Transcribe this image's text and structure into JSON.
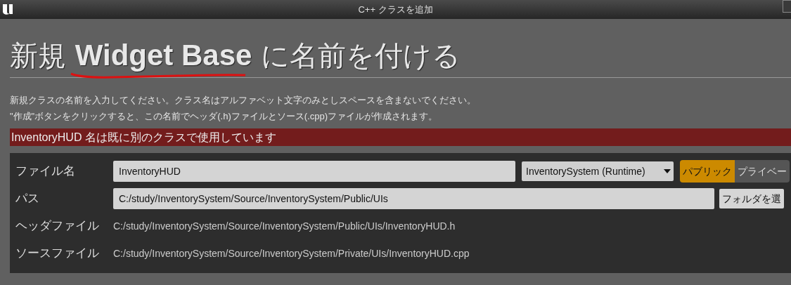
{
  "window": {
    "title": "C++ クラスを追加"
  },
  "heading": "新規 **Widget Base** に名前を付ける",
  "description": [
    "新規クラスの名前を入力してください。クラス名はアルファベット文字のみとしスペースを含まないでください。",
    "\"作成\"ボタンをクリックすると、この名前でヘッダ(.h)ファイルとソース(.cpp)ファイルが作成されます。"
  ],
  "error": "InventoryHUD 名は既に別のクラスで使用しています",
  "rows": [
    {
      "kind": "name",
      "label": "ファイル名",
      "value": "InventoryHUD",
      "module": "InventorySystem (Runtime)",
      "visibility": [
        {
          "label": "パブリック",
          "selected": true
        },
        {
          "label": "プライベー",
          "selected": false
        }
      ]
    },
    {
      "kind": "path",
      "label": "パス",
      "value": "C:/study/InventorySystem/Source/InventorySystem/Public/UIs",
      "button": "フォルダを選"
    },
    {
      "kind": "text",
      "label": "ヘッダファイル",
      "value": "C:/study/InventorySystem/Source/InventorySystem/Public/UIs/InventoryHUD.h"
    },
    {
      "kind": "text",
      "label": "ソースファイル",
      "value": "C:/study/InventorySystem/Source/InventorySystem/Private/UIs/InventoryHUD.cpp"
    }
  ]
}
